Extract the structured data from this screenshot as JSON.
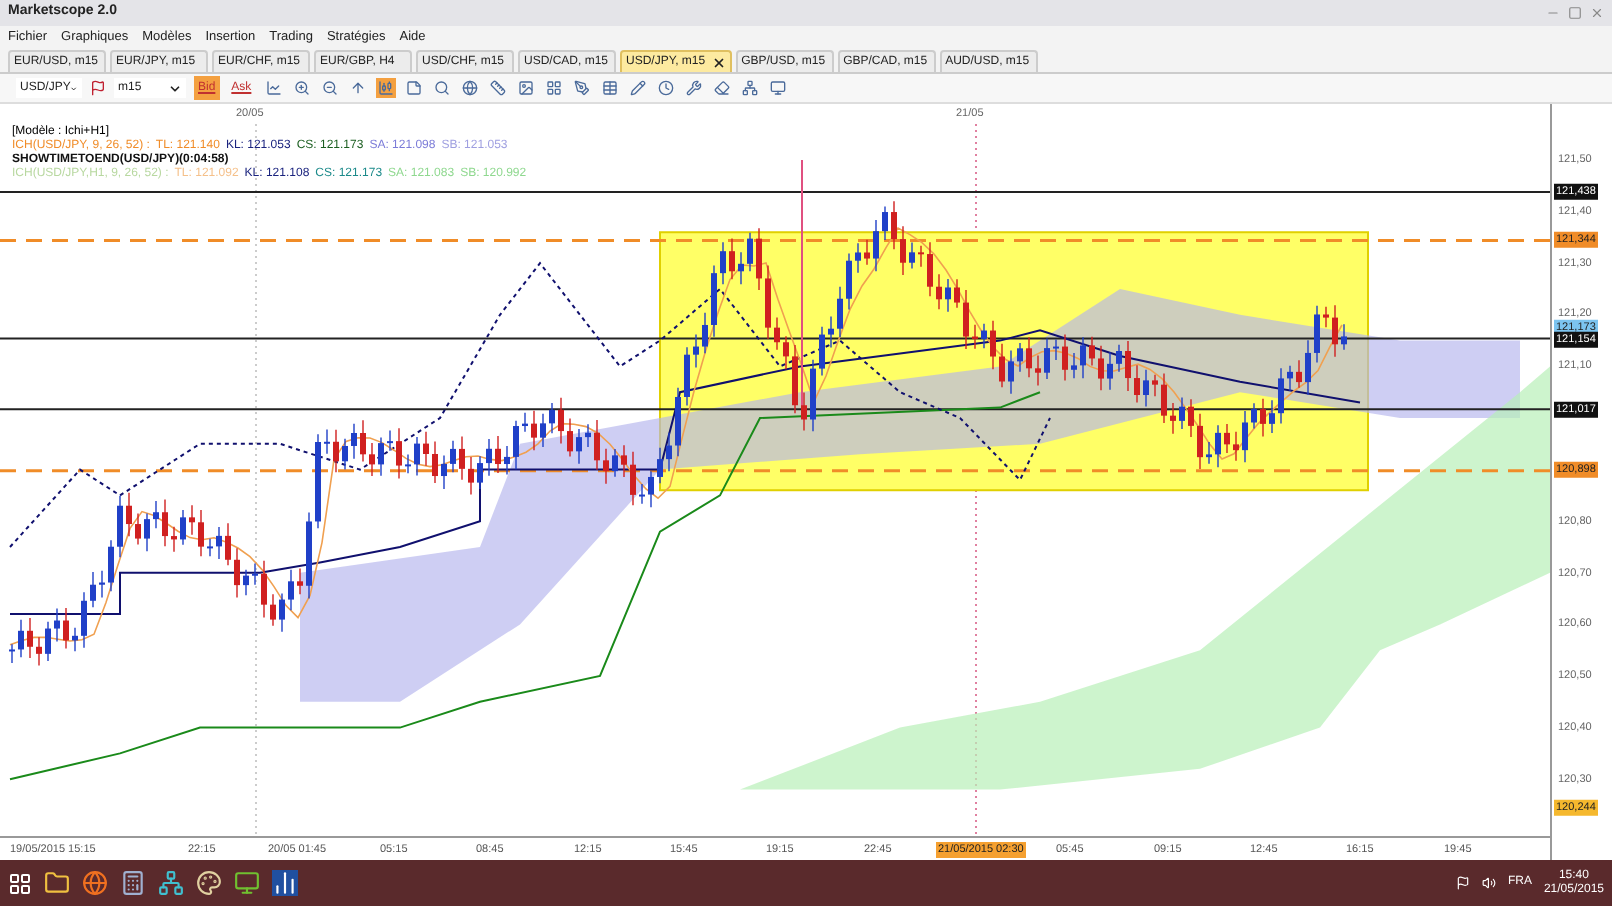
{
  "window": {
    "title": "Marketscope 2.0"
  },
  "menu": [
    "Fichier",
    "Graphiques",
    "Modèles",
    "Insertion",
    "Trading",
    "Stratégies",
    "Aide"
  ],
  "tabs": [
    {
      "label": "EUR/USD, m15",
      "selected": false
    },
    {
      "label": "EUR/JPY, m15",
      "selected": false
    },
    {
      "label": "EUR/CHF, m15",
      "selected": false
    },
    {
      "label": "EUR/GBP, H4",
      "selected": false
    },
    {
      "label": "USD/CHF, m15",
      "selected": false
    },
    {
      "label": "USD/CAD, m15",
      "selected": false
    },
    {
      "label": "USD/JPY, m15",
      "selected": true
    },
    {
      "label": "GBP/USD, m15",
      "selected": false
    },
    {
      "label": "GBP/CAD, m15",
      "selected": false
    },
    {
      "label": "AUD/USD, m15",
      "selected": false
    }
  ],
  "toolbar": {
    "symbol": "USD/JPY",
    "period": "m15",
    "price_buttons": [
      {
        "label": "Bid",
        "selected": true
      },
      {
        "label": "Ask",
        "selected": false
      }
    ],
    "tools": [
      {
        "selected": false
      },
      {
        "selected": false
      },
      {
        "selected": false
      },
      {
        "selected": false
      },
      {
        "selected": true
      },
      {
        "selected": false
      },
      {
        "selected": false
      },
      {
        "selected": false
      },
      {
        "selected": false
      },
      {
        "selected": false
      },
      {
        "selected": false
      },
      {
        "selected": false
      },
      {
        "selected": false
      },
      {
        "selected": false
      },
      {
        "selected": false
      },
      {
        "selected": false
      },
      {
        "selected": false
      },
      {
        "selected": false
      },
      {
        "selected": false
      }
    ]
  },
  "chart": {
    "date_labels": [
      "20/05",
      "21/05"
    ],
    "legend": [
      {
        "parts": [
          {
            "text": "[Modèle : Ichi+H1]",
            "color": "#000000"
          }
        ]
      },
      {
        "parts": [
          {
            "text": "ICH(USD/JPY, 9, 26, 52) :",
            "color": "#f08c28"
          },
          {
            "text": "TL: 121.140",
            "color": "#f08c28"
          },
          {
            "text": "KL: 121.053",
            "color": "#1a237e"
          },
          {
            "text": "CS: 121.173",
            "color": "#1b5e20"
          },
          {
            "text": "SA: 121.098",
            "color": "#7b7bd8"
          },
          {
            "text": "SB: 121.053",
            "color": "#9f9fe0"
          }
        ]
      },
      {
        "parts": [
          {
            "text": "SHOWTIMETOEND(USD/JPY)(0:04:58)",
            "color": "#111111"
          }
        ]
      },
      {
        "parts": [
          {
            "text": "ICH(USD/JPY,H1, 9, 26, 52) :",
            "color": "#b8d8a0"
          },
          {
            "text": "TL: 121.092",
            "color": "#f5c08a"
          },
          {
            "text": "KL: 121.108",
            "color": "#1a237e"
          },
          {
            "text": "CS: 121.173",
            "color": "#1b8a8a"
          },
          {
            "text": "SA: 121.083",
            "color": "#8fd88f"
          },
          {
            "text": "SB: 120.992",
            "color": "#8fd88f"
          }
        ]
      }
    ],
    "y_axis_labels": [
      "121,50",
      "121,40",
      "121,30",
      "121,20",
      "121,10",
      "120,80",
      "120,70",
      "120,60",
      "120,50",
      "120,40",
      "120,30"
    ],
    "price_markers": [
      {
        "label": "121,438",
        "color": "#111111"
      },
      {
        "label": "121,344",
        "color": "#f08c28"
      },
      {
        "label": "121,173",
        "color": "#7cc4f0"
      },
      {
        "label": "121,154",
        "color": "#111111"
      },
      {
        "label": "121,017",
        "color": "#111111"
      },
      {
        "label": "120,898",
        "color": "#f08c28"
      },
      {
        "label": "120,244",
        "color": "#f5b82e"
      }
    ],
    "time_labels": [
      {
        "label": "19/05/2015 15:15",
        "highlighted": false
      },
      {
        "label": "22:15",
        "highlighted": false
      },
      {
        "label": "20/05 01:45",
        "highlighted": false
      },
      {
        "label": "05:15",
        "highlighted": false
      },
      {
        "label": "08:45",
        "highlighted": false
      },
      {
        "label": "12:15",
        "highlighted": false
      },
      {
        "label": "15:45",
        "highlighted": false
      },
      {
        "label": "19:15",
        "highlighted": false
      },
      {
        "label": "22:45",
        "highlighted": false
      },
      {
        "label": "21/05/2015 02:30",
        "highlighted": true
      },
      {
        "label": "05:45",
        "highlighted": false
      },
      {
        "label": "09:15",
        "highlighted": false
      },
      {
        "label": "12:45",
        "highlighted": false
      },
      {
        "label": "16:15",
        "highlighted": false
      },
      {
        "label": "19:45",
        "highlighted": false
      }
    ]
  },
  "taskbar": {
    "language": "FRA",
    "time": "15:40",
    "date": "21/05/2015"
  }
}
